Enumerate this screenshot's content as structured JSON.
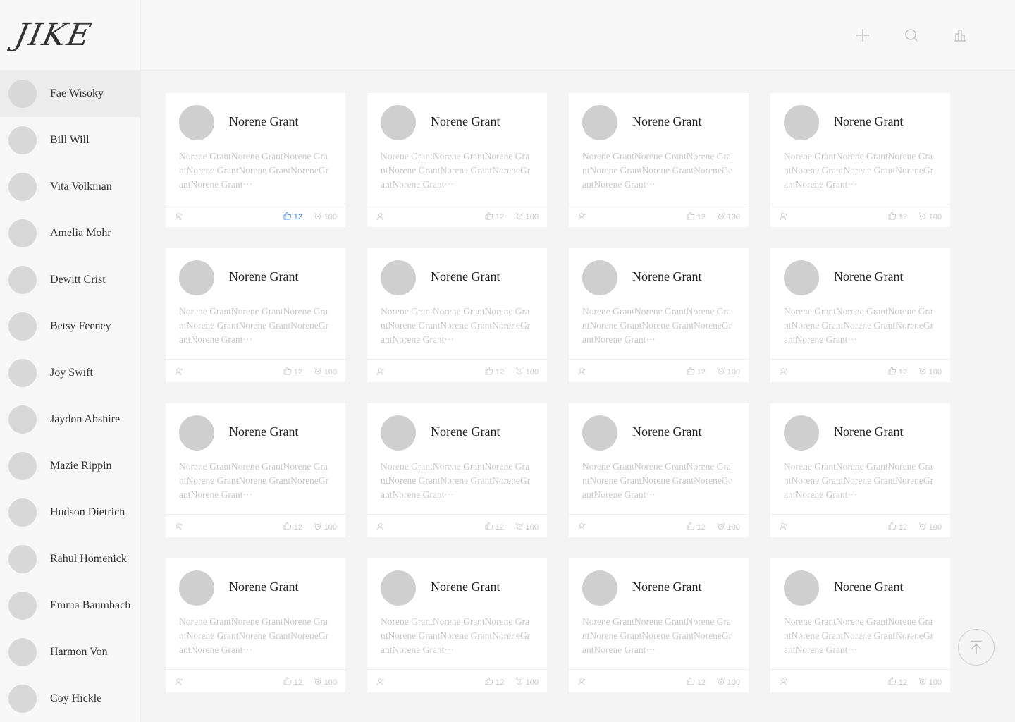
{
  "brand": {
    "logo_text": "JIKE"
  },
  "sidebar": {
    "users": [
      {
        "name": "Fae Wisoky",
        "active": true
      },
      {
        "name": "Bill Will"
      },
      {
        "name": "Vita Volkman"
      },
      {
        "name": "Amelia Mohr"
      },
      {
        "name": "Dewitt Crist"
      },
      {
        "name": "Betsy Feeney"
      },
      {
        "name": "Joy Swift"
      },
      {
        "name": "Jaydon Abshire"
      },
      {
        "name": "Mazie Rippin"
      },
      {
        "name": "Hudson Dietrich"
      },
      {
        "name": "Rahul Homenick"
      },
      {
        "name": "Emma Baumbach"
      },
      {
        "name": "Harmon Von"
      },
      {
        "name": "Coy Hickle"
      }
    ]
  },
  "header": {
    "icons": [
      "plus-icon",
      "search-icon",
      "chart-icon"
    ]
  },
  "cards": [
    {
      "author": "Norene Grant",
      "body": "Norene GrantNorene GrantNorene GrantNorene GrantNorene GrantNoreneGrantNorene Grant···",
      "likes": "12",
      "views": "100",
      "liked": true
    },
    {
      "author": "Norene Grant",
      "body": "Norene GrantNorene GrantNorene GrantNorene GrantNorene GrantNoreneGrantNorene Grant···",
      "likes": "12",
      "views": "100"
    },
    {
      "author": "Norene Grant",
      "body": "Norene GrantNorene GrantNorene GrantNorene GrantNorene GrantNoreneGrantNorene Grant···",
      "likes": "12",
      "views": "100"
    },
    {
      "author": "Norene Grant",
      "body": "Norene GrantNorene GrantNorene GrantNorene GrantNorene GrantNoreneGrantNorene Grant···",
      "likes": "12",
      "views": "100"
    },
    {
      "author": "Norene Grant",
      "body": "Norene GrantNorene GrantNorene GrantNorene GrantNorene GrantNoreneGrantNorene Grant···",
      "likes": "12",
      "views": "100"
    },
    {
      "author": "Norene Grant",
      "body": "Norene GrantNorene GrantNorene GrantNorene GrantNorene GrantNoreneGrantNorene Grant···",
      "likes": "12",
      "views": "100"
    },
    {
      "author": "Norene Grant",
      "body": "Norene GrantNorene GrantNorene GrantNorene GrantNorene GrantNoreneGrantNorene Grant···",
      "likes": "12",
      "views": "100"
    },
    {
      "author": "Norene Grant",
      "body": "Norene GrantNorene GrantNorene GrantNorene GrantNorene GrantNoreneGrantNorene Grant···",
      "likes": "12",
      "views": "100"
    },
    {
      "author": "Norene Grant",
      "body": "Norene GrantNorene GrantNorene GrantNorene GrantNorene GrantNoreneGrantNorene Grant···",
      "likes": "12",
      "views": "100"
    },
    {
      "author": "Norene Grant",
      "body": "Norene GrantNorene GrantNorene GrantNorene GrantNorene GrantNoreneGrantNorene Grant···",
      "likes": "12",
      "views": "100"
    },
    {
      "author": "Norene Grant",
      "body": "Norene GrantNorene GrantNorene GrantNorene GrantNorene GrantNoreneGrantNorene Grant···",
      "likes": "12",
      "views": "100"
    },
    {
      "author": "Norene Grant",
      "body": "Norene GrantNorene GrantNorene GrantNorene GrantNorene GrantNoreneGrantNorene Grant···",
      "likes": "12",
      "views": "100"
    },
    {
      "author": "Norene Grant",
      "body": "Norene GrantNorene GrantNorene GrantNorene GrantNorene GrantNoreneGrantNorene Grant···",
      "likes": "12",
      "views": "100"
    },
    {
      "author": "Norene Grant",
      "body": "Norene GrantNorene GrantNorene GrantNorene GrantNorene GrantNoreneGrantNorene Grant···",
      "likes": "12",
      "views": "100"
    },
    {
      "author": "Norene Grant",
      "body": "Norene GrantNorene GrantNorene GrantNorene GrantNorene GrantNoreneGrantNorene Grant···",
      "likes": "12",
      "views": "100"
    },
    {
      "author": "Norene Grant",
      "body": "Norene GrantNorene GrantNorene GrantNorene GrantNorene GrantNoreneGrantNorene Grant···",
      "likes": "12",
      "views": "100"
    }
  ],
  "colors": {
    "accent": "#4a90e2",
    "muted": "#c8c8c8",
    "avatar": "#cfcfcf"
  },
  "back_to_top": {
    "icon": "arrow-up-to-top-icon"
  }
}
